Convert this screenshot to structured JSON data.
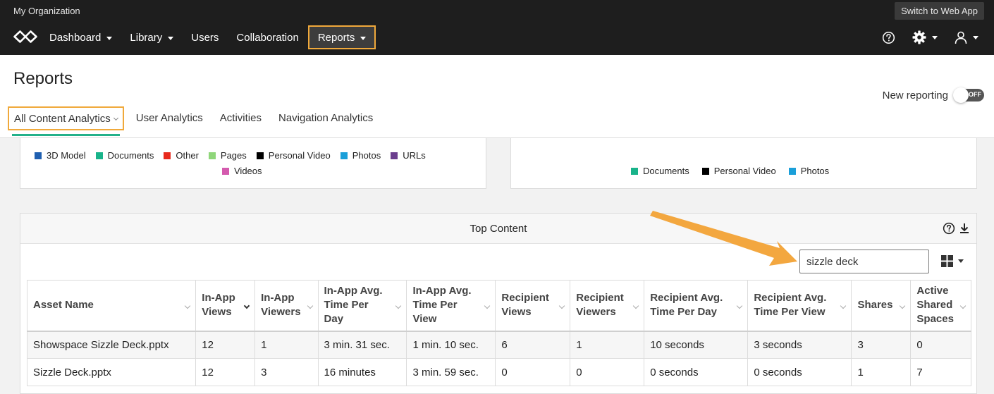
{
  "topbar": {
    "org_name": "My Organization",
    "switch_label": "Switch to Web App",
    "nav": [
      {
        "label": "Dashboard",
        "caret": true
      },
      {
        "label": "Library",
        "caret": true
      },
      {
        "label": "Users",
        "caret": false
      },
      {
        "label": "Collaboration",
        "caret": false
      },
      {
        "label": "Reports",
        "caret": true,
        "active": true
      }
    ],
    "right_icons": [
      "help-circle-icon",
      "gear-icon",
      "user-icon"
    ]
  },
  "page": {
    "title": "Reports",
    "new_reporting_label": "New reporting",
    "toggle_state": "OFF"
  },
  "tabs": [
    {
      "label": "All Content Analytics",
      "active": true
    },
    {
      "label": "User Analytics"
    },
    {
      "label": "Activities"
    },
    {
      "label": "Navigation Analytics"
    }
  ],
  "legend_left": {
    "row1": [
      {
        "label": "3D Model",
        "color": "#1f5fb0"
      },
      {
        "label": "Documents",
        "color": "#19b38a"
      },
      {
        "label": "Other",
        "color": "#e8291c"
      },
      {
        "label": "Pages",
        "color": "#8fd67a"
      },
      {
        "label": "Personal Video",
        "color": "#000000"
      },
      {
        "label": "Photos",
        "color": "#1a9fd9"
      },
      {
        "label": "URLs",
        "color": "#6b3e8e"
      }
    ],
    "row2": [
      {
        "label": "Videos",
        "color": "#d45aae"
      }
    ]
  },
  "legend_right": [
    {
      "label": "Documents",
      "color": "#19b38a"
    },
    {
      "label": "Personal Video",
      "color": "#000000"
    },
    {
      "label": "Photos",
      "color": "#1a9fd9"
    }
  ],
  "top_content": {
    "title": "Top Content",
    "search_value": "sizzle deck",
    "columns": [
      "Asset Name",
      "In-App Views",
      "In-App Viewers",
      "In-App Avg. Time Per Day",
      "In-App Avg. Time Per View",
      "Recipient Views",
      "Recipient Viewers",
      "Recipient Avg. Time Per Day",
      "Recipient Avg. Time Per View",
      "Shares",
      "Active Shared Spaces"
    ],
    "rows": [
      [
        "Showspace Sizzle Deck.pptx",
        "12",
        "1",
        "3 min. 31 sec.",
        "1 min. 10 sec.",
        "6",
        "1",
        "10 seconds",
        "3 seconds",
        "3",
        "0"
      ],
      [
        "Sizzle Deck.pptx",
        "12",
        "3",
        "16 minutes",
        "3 min. 59 sec.",
        "0",
        "0",
        "0 seconds",
        "0 seconds",
        "1",
        "7"
      ]
    ]
  },
  "colors": {
    "accent_highlight": "#f0a93b",
    "tab_indicator": "#23b18a",
    "topbar_bg": "#1e1e1e"
  }
}
